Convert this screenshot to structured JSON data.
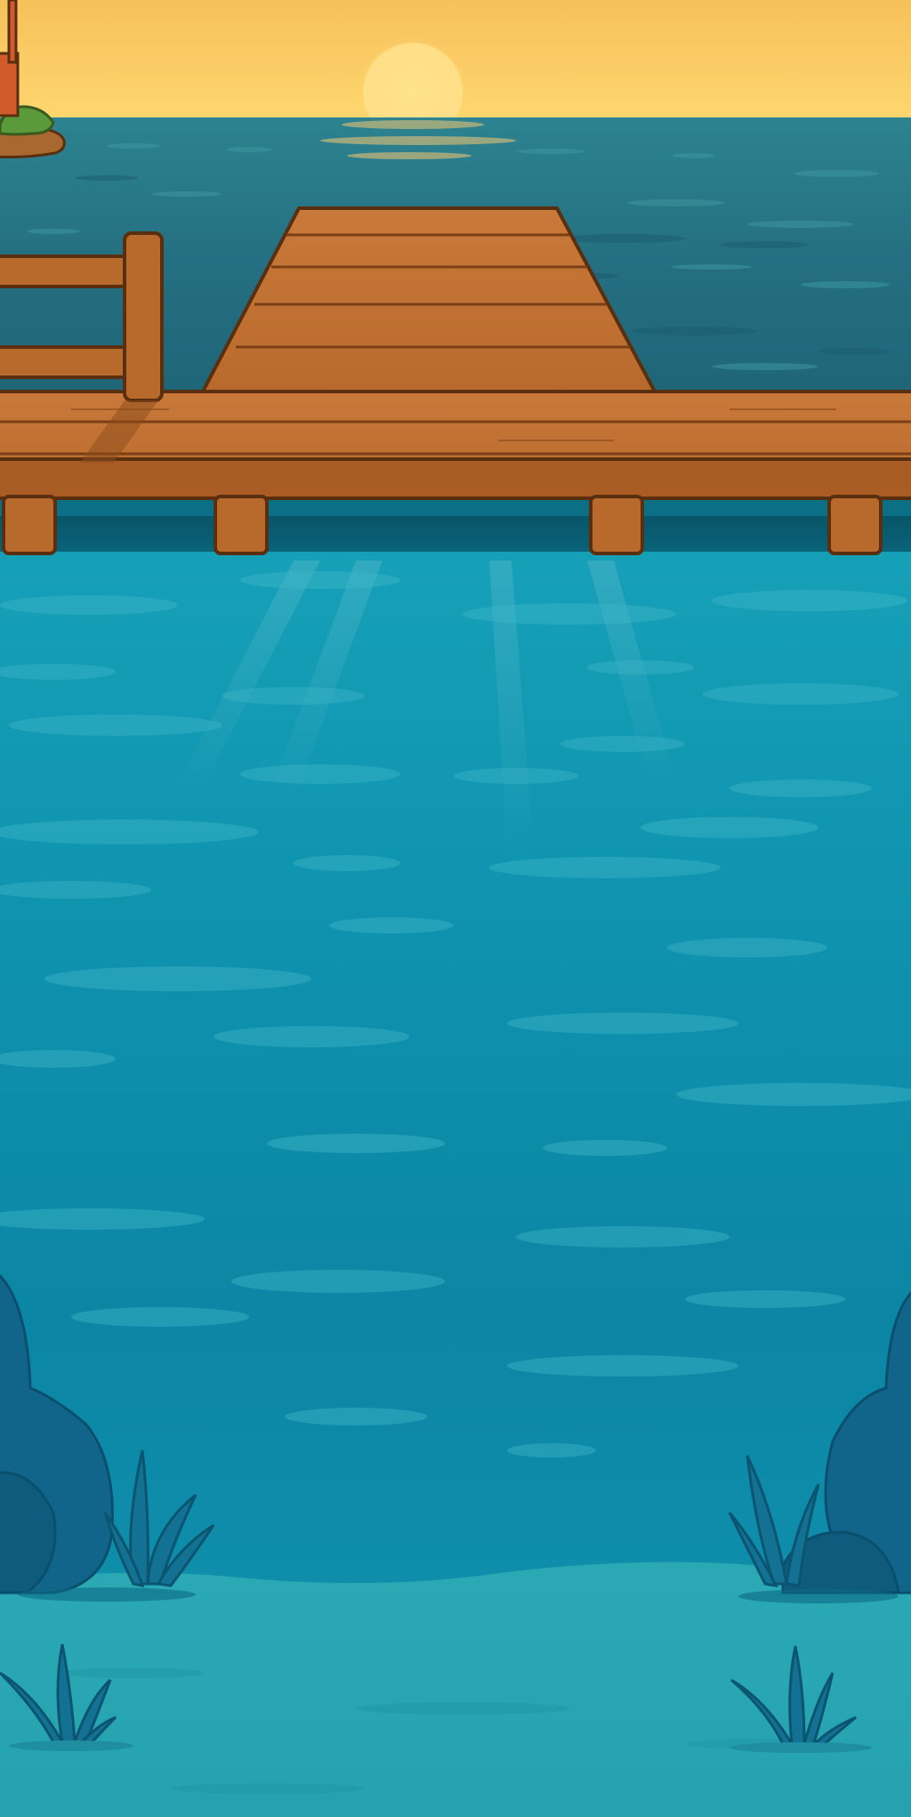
{
  "scene": {
    "kind": "fishing-game-background",
    "time_of_day": "sunset",
    "has_text": false
  },
  "colors": {
    "sky_top": "#f6c15b",
    "sky_bottom": "#ffd66e",
    "sun": "#ffe08a",
    "ocean_far": "#2a7d86",
    "ocean_near": "#1f6d7e",
    "water_surface": "#1699b1",
    "water_deep": "#0b86a4",
    "seabed": "#2aa9b4",
    "rock": "#12658a",
    "rock_outline": "#0a4f6d",
    "plant": "#137193",
    "dock_plank": "#b86a2c",
    "dock_plank_light": "#c9793a",
    "dock_outline": "#5a2f0f",
    "dock_shadow": "#8c4b1b",
    "island_grass": "#5a9a3a",
    "island_dirt": "#a9682f",
    "lighthouse": "#d35a2a"
  },
  "elements": {
    "sun": "sun-shape",
    "dock": "wooden-pier",
    "railing": "wooden-railing",
    "rocks": [
      "left-rock",
      "right-rock"
    ],
    "plants": [
      "seaweed-left-upper",
      "seaweed-left-lower",
      "seaweed-right-upper",
      "seaweed-right-lower"
    ],
    "island": "small-island-with-lighthouse"
  }
}
